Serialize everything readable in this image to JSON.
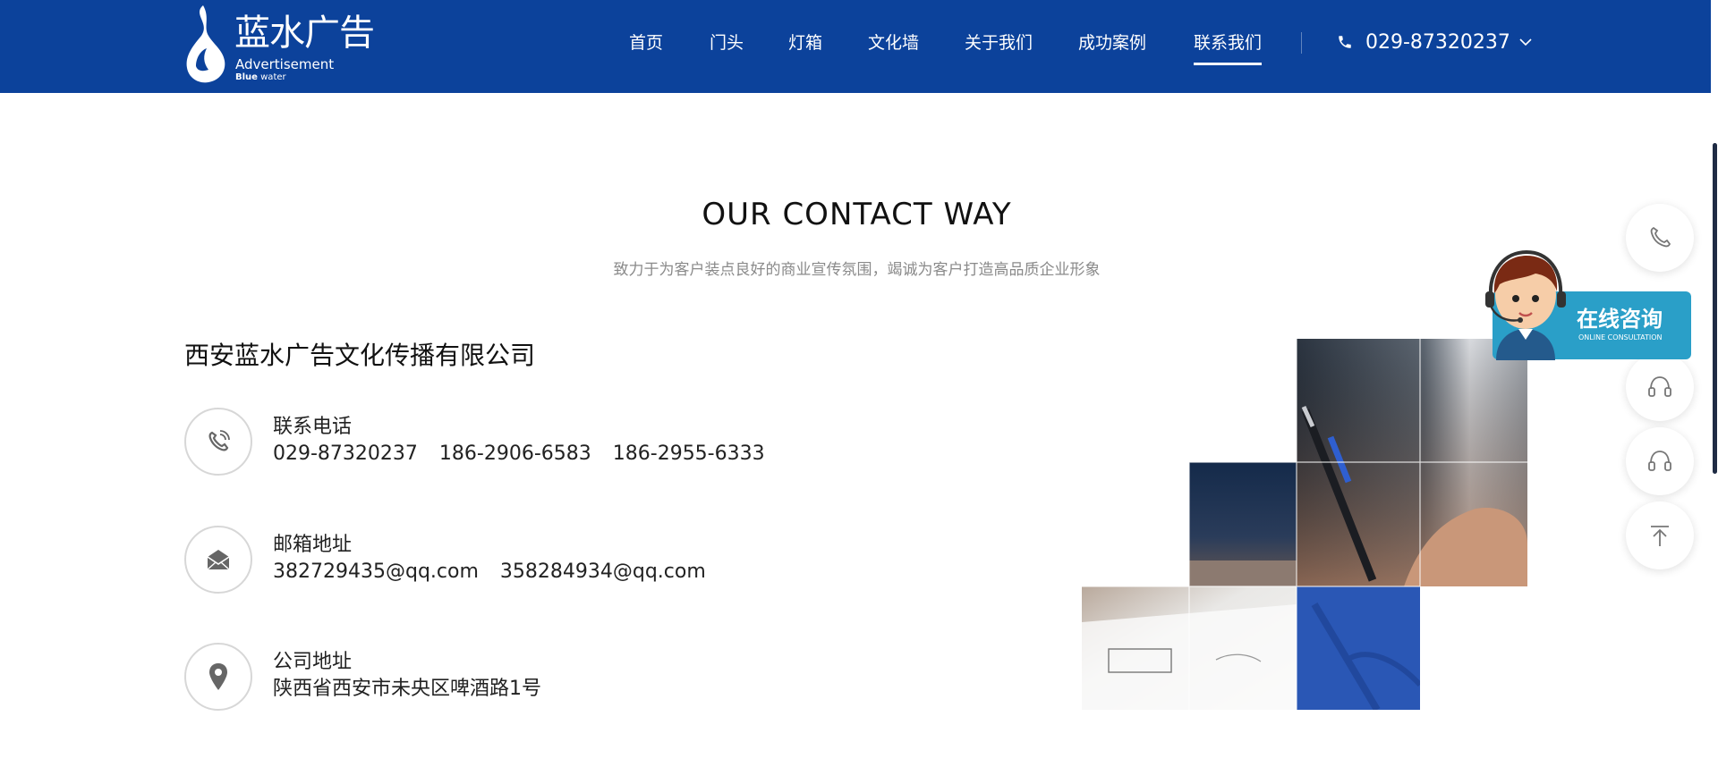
{
  "header": {
    "logo": {
      "cn": "蓝水广告",
      "en_line1": "Advertisement",
      "en_line2_bold": "Blue",
      "en_line2": " water"
    },
    "nav": [
      "首页",
      "门头",
      "灯箱",
      "文化墙",
      "关于我们",
      "成功案例",
      "联系我们"
    ],
    "active_nav": "联系我们",
    "phone": "029-87320237"
  },
  "main": {
    "title": "OUR CONTACT WAY",
    "subtitle": "致力于为客户装点良好的商业宣传氛围，竭诚为客户打造高品质企业形象",
    "company": "西安蓝水广告文化传播有限公司",
    "contacts": [
      {
        "icon": "phone-icon",
        "label": "联系电话",
        "values": [
          "029-87320237",
          "186-2906-6583",
          "186-2955-6333"
        ]
      },
      {
        "icon": "mail-icon",
        "label": "邮箱地址",
        "values": [
          "382729435@qq.com",
          "358284934@qq.com"
        ]
      },
      {
        "icon": "location-pin-icon",
        "label": "公司地址",
        "values": [
          "陕西省西安市未央区啤酒路1号"
        ]
      }
    ]
  },
  "side": {
    "consult_title": "在线咨询",
    "consult_sub": "ONLINE CONSULTATION",
    "buttons": [
      "phone-icon",
      "headset-icon",
      "headset-icon",
      "back-to-top-icon"
    ]
  },
  "colors": {
    "header_bg": "#0c429b",
    "accent_tile": "#2a57b5",
    "consult": "#2a9fc8"
  }
}
